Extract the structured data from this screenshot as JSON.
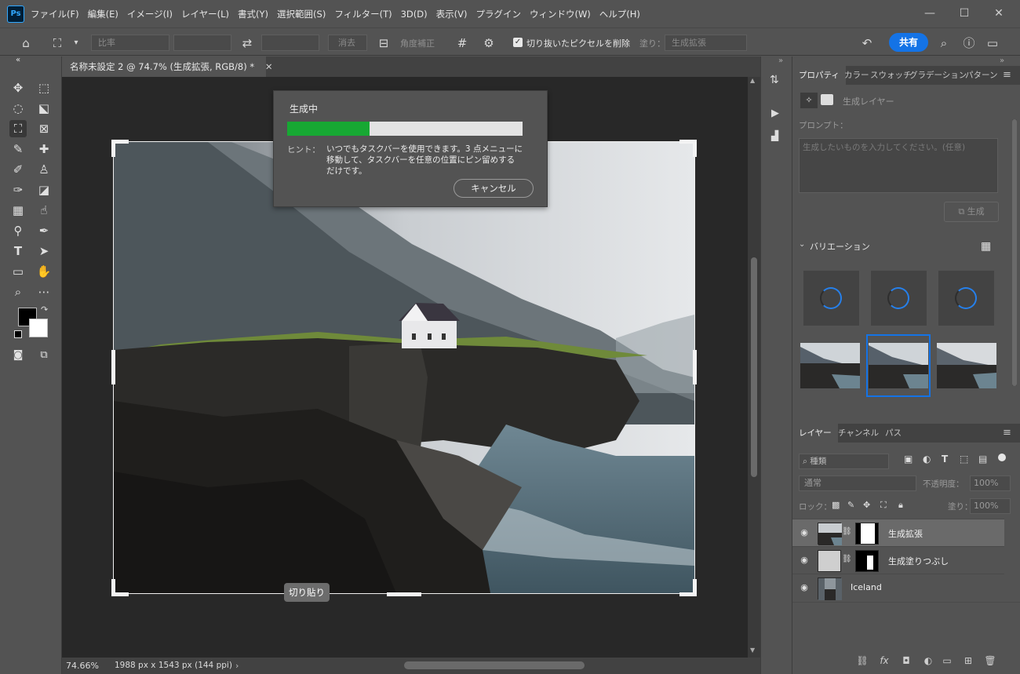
{
  "menu": {
    "app_badge": "Ps",
    "items": [
      "ファイル(F)",
      "編集(E)",
      "イメージ(I)",
      "レイヤー(L)",
      "書式(Y)",
      "選択範囲(S)",
      "フィルター(T)",
      "3D(D)",
      "表示(V)",
      "プラグイン",
      "ウィンドウ(W)",
      "ヘルプ(H)"
    ]
  },
  "options": {
    "ratio_label": "比率",
    "clear_label": "消去",
    "straighten_label": "角度補正",
    "delete_cropped_label": "切り抜いたピクセルを削除",
    "fill_label": "塗り：",
    "fill_value": "生成拡張",
    "share_label": "共有"
  },
  "document": {
    "tab_title": "名称未設定 2 @ 74.7% (生成拡張, RGB/8) *",
    "zoom": "74.66%",
    "doc_info": "1988 px x 1543 px (144 ppi)"
  },
  "dialog": {
    "title": "生成中",
    "progress": 0.35,
    "hint_label": "ヒント：",
    "hint_lines": [
      "いつでもタスクバーを使用できます。3 点メニューに",
      "移動して、タスクバーを任意の位置にピン留めする",
      "だけです。"
    ],
    "cancel_label": "キャンセル"
  },
  "canvas": {
    "paste_tooltip": "切り貼り"
  },
  "properties": {
    "tabs": [
      "プロパティ",
      "カラー",
      "スウォッチ",
      "グラデーション",
      "パターン"
    ],
    "layer_type": "生成レイヤー",
    "prompt_label": "プロンプト：",
    "prompt_placeholder": "生成したいものを入力してください。(任意)",
    "generate_label": "生成",
    "variations_label": "バリエーション"
  },
  "layers_panel": {
    "tabs": [
      "レイヤー",
      "チャンネル",
      "パス"
    ],
    "filter_kind": "種類",
    "blend_mode": "通常",
    "opacity_label": "不透明度：",
    "opacity_value": "100%",
    "lock_label": "ロック：",
    "fill_label": "塗り：",
    "fill_value": "100%",
    "layers": [
      {
        "name": "生成拡張",
        "selected": true
      },
      {
        "name": "生成塗りつぶし",
        "selected": false
      },
      {
        "name": "Iceland",
        "selected": false
      }
    ]
  },
  "colors": {
    "accent": "#1473e6",
    "progress": "#17a833",
    "panel": "#535353",
    "canvas_bg": "#282828"
  }
}
